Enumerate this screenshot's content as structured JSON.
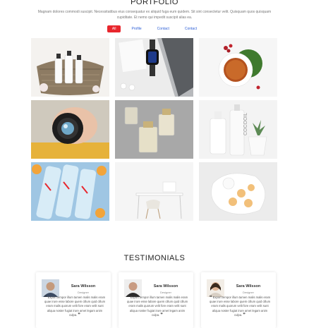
{
  "portfolio": {
    "title": "PORTFOLIO",
    "description": "Magnam dolores commodi suscipit. Necessitatibus eius consequatur ex aliquid fuga eum quidem. Sit sint consectetur velit. Quisquam quos quisquam cupiditate. Et nemo qui impedit suscipit alias ea.",
    "filters": [
      {
        "label": "All",
        "active": true
      },
      {
        "label": "Profile",
        "active": false
      },
      {
        "label": "Contact",
        "active": false
      },
      {
        "label": "Contact",
        "active": false
      }
    ],
    "items": [
      {
        "subject": "cosmetics-basket"
      },
      {
        "subject": "laptop-smartwatch-earbuds"
      },
      {
        "subject": "tea-cup-berries"
      },
      {
        "subject": "camera-lens"
      },
      {
        "subject": "perfume-bottles"
      },
      {
        "subject": "coconut-lotion-plant"
      },
      {
        "subject": "water-bottles-fruit"
      },
      {
        "subject": "white-desk-chair"
      },
      {
        "subject": "cookies-plate"
      }
    ]
  },
  "testimonials": {
    "title": "TESTIMONIALS",
    "cards": [
      {
        "name": "Sara Wilsson",
        "role": "Designer",
        "quote": "Export tempor illum tamen malis malis eram quae irure esse labore quem cillum quid cillum eram malis quorum velit fore eram velit sunt aliqua noster fugiat irure amet legam anim culpa."
      },
      {
        "name": "Sara Wilsson",
        "role": "Designer",
        "quote": "Export tempor illum tamen malis malis eram quae irure esse labore quem cillum quid cillum eram malis quorum velit fore eram velit sunt aliqua noster fugiat irure amet legam anim culpa."
      },
      {
        "name": "Sara Wilsson",
        "role": "Designer",
        "quote": "Export tempor illum tamen malis malis eram quae irure esse labore quem cillum quid cillum eram malis quorum velit fore eram velit sunt aliqua noster fugiat irure amet legam anim culpa."
      }
    ]
  },
  "colors": {
    "accent": "#e8262d",
    "link": "#2b5dd6"
  }
}
